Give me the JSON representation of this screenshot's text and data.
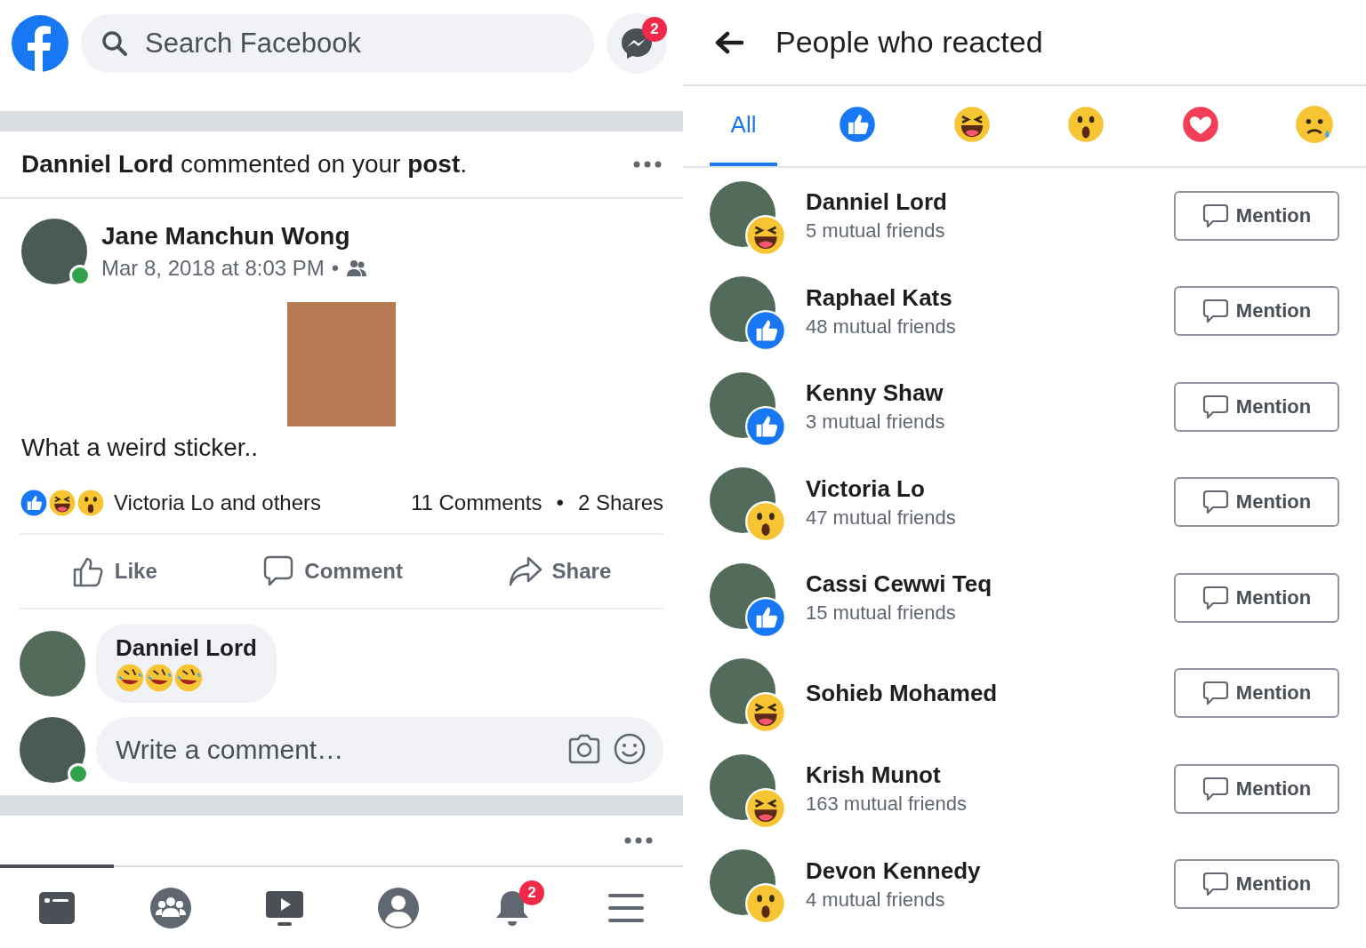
{
  "left": {
    "search": {
      "placeholder": "Search Facebook"
    },
    "messenger_badge": "2",
    "notification": {
      "text": "**Danniel Lord** commented on your **post**."
    },
    "post": {
      "author": "Jane Manchun Wong",
      "author_online": true,
      "time": "Mar 8, 2018 at 8:03 PM",
      "separator": "•",
      "text": "What a weird sticker..",
      "reactions": [
        {
          "kind": "like"
        },
        {
          "kind": "haha"
        },
        {
          "kind": "wow"
        }
      ],
      "reactions_text": "Victoria Lo and others",
      "comments": "11 Comments",
      "dot": "•",
      "shares": "2 Shares"
    },
    "actions": [
      {
        "kind": "like",
        "label": "Like"
      },
      {
        "kind": "comment",
        "label": "Comment"
      },
      {
        "kind": "share",
        "label": "Share"
      }
    ],
    "comment": {
      "author": "Danniel Lord",
      "stickers": [
        {
          "kind": "rofl"
        },
        {
          "kind": "rofl"
        },
        {
          "kind": "rofl"
        }
      ]
    },
    "composer": {
      "placeholder": "Write a comment…",
      "online": true
    },
    "nav": [
      {
        "kind": "home",
        "selected": true
      },
      {
        "kind": "groups",
        "selected": false
      },
      {
        "kind": "watch",
        "selected": false
      },
      {
        "kind": "profile",
        "selected": false
      },
      {
        "kind": "bell",
        "selected": false,
        "badge": "2"
      },
      {
        "kind": "menu",
        "selected": false
      }
    ]
  },
  "right": {
    "title": "People who reacted",
    "tabs": [
      {
        "kind": "all",
        "label": "All",
        "selected": true
      },
      {
        "kind": "like",
        "selected": false
      },
      {
        "kind": "haha",
        "selected": false
      },
      {
        "kind": "wow",
        "selected": false
      },
      {
        "kind": "love",
        "selected": false
      },
      {
        "kind": "sad",
        "selected": false
      }
    ],
    "people": [
      {
        "name": "Danniel Lord",
        "mutual": "5 mutual friends",
        "reaction": {
          "kind": "haha"
        },
        "button": "Mention"
      },
      {
        "name": "Raphael Kats",
        "mutual": "48 mutual friends",
        "reaction": {
          "kind": "like"
        },
        "button": "Mention"
      },
      {
        "name": "Kenny Shaw",
        "mutual": "3 mutual friends",
        "reaction": {
          "kind": "like"
        },
        "button": "Mention"
      },
      {
        "name": "Victoria Lo",
        "mutual": "47 mutual friends",
        "reaction": {
          "kind": "wow"
        },
        "button": "Mention"
      },
      {
        "name": "Cassi Cewwi Teq",
        "mutual": "15 mutual friends",
        "reaction": {
          "kind": "like"
        },
        "button": "Mention"
      },
      {
        "name": "Sohieb Mohamed",
        "reaction": {
          "kind": "haha"
        },
        "button": "Mention"
      },
      {
        "name": "Krish Munot",
        "mutual": "163 mutual friends",
        "reaction": {
          "kind": "haha"
        },
        "button": "Mention"
      },
      {
        "name": "Devon Kennedy",
        "mutual": "4 mutual friends",
        "reaction": {
          "kind": "wow"
        },
        "button": "Mention"
      }
    ]
  }
}
